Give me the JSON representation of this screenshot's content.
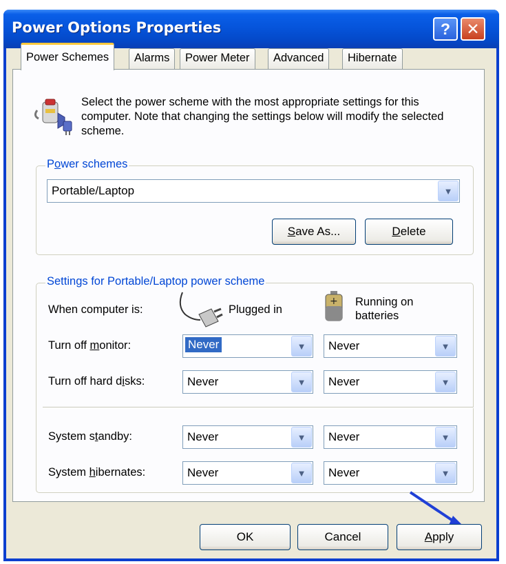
{
  "window": {
    "title": "Power Options Properties"
  },
  "titlebar": {
    "help_glyph": "?",
    "close_glyph": "✕"
  },
  "tabs": [
    {
      "label": "Power Schemes",
      "active": true
    },
    {
      "label": "Alarms"
    },
    {
      "label": "Power Meter"
    },
    {
      "label": "Advanced"
    },
    {
      "label": "Hibernate"
    }
  ],
  "intro": {
    "text": "Select the power scheme with the most appropriate settings for this computer. Note that changing the settings below will modify the selected scheme."
  },
  "power_schemes": {
    "label_prefix": "P",
    "label_accel": "o",
    "label_rest": "wer schemes",
    "selected": "Portable/Laptop",
    "save_as_accel": "S",
    "save_as_rest": "ave As...",
    "delete_accel": "D",
    "delete_rest": "elete"
  },
  "settings": {
    "group_label": "Settings for Portable/Laptop power scheme",
    "when_label": "When computer is:",
    "plugged_in": "Plugged in",
    "on_batteries_line1": "Running on",
    "on_batteries_line2": "batteries",
    "rows": [
      {
        "pre": "Turn off ",
        "accel": "m",
        "post": "onitor:",
        "plugged": "Never",
        "battery": "Never"
      },
      {
        "pre": "Turn off hard d",
        "accel": "i",
        "post": "sks:",
        "plugged": "Never",
        "battery": "Never"
      },
      {
        "pre": "System s",
        "accel": "t",
        "post": "andby:",
        "plugged": "Never",
        "battery": "Never"
      },
      {
        "pre": "System ",
        "accel": "h",
        "post": "ibernates:",
        "plugged": "Never",
        "battery": "Never"
      }
    ]
  },
  "footer": {
    "ok": "OK",
    "cancel": "Cancel",
    "apply_accel": "A",
    "apply_rest": "pply"
  },
  "colors": {
    "arrow": "#1f3fd6",
    "title_bar": "#0553d9",
    "group_label": "#0046d5"
  }
}
